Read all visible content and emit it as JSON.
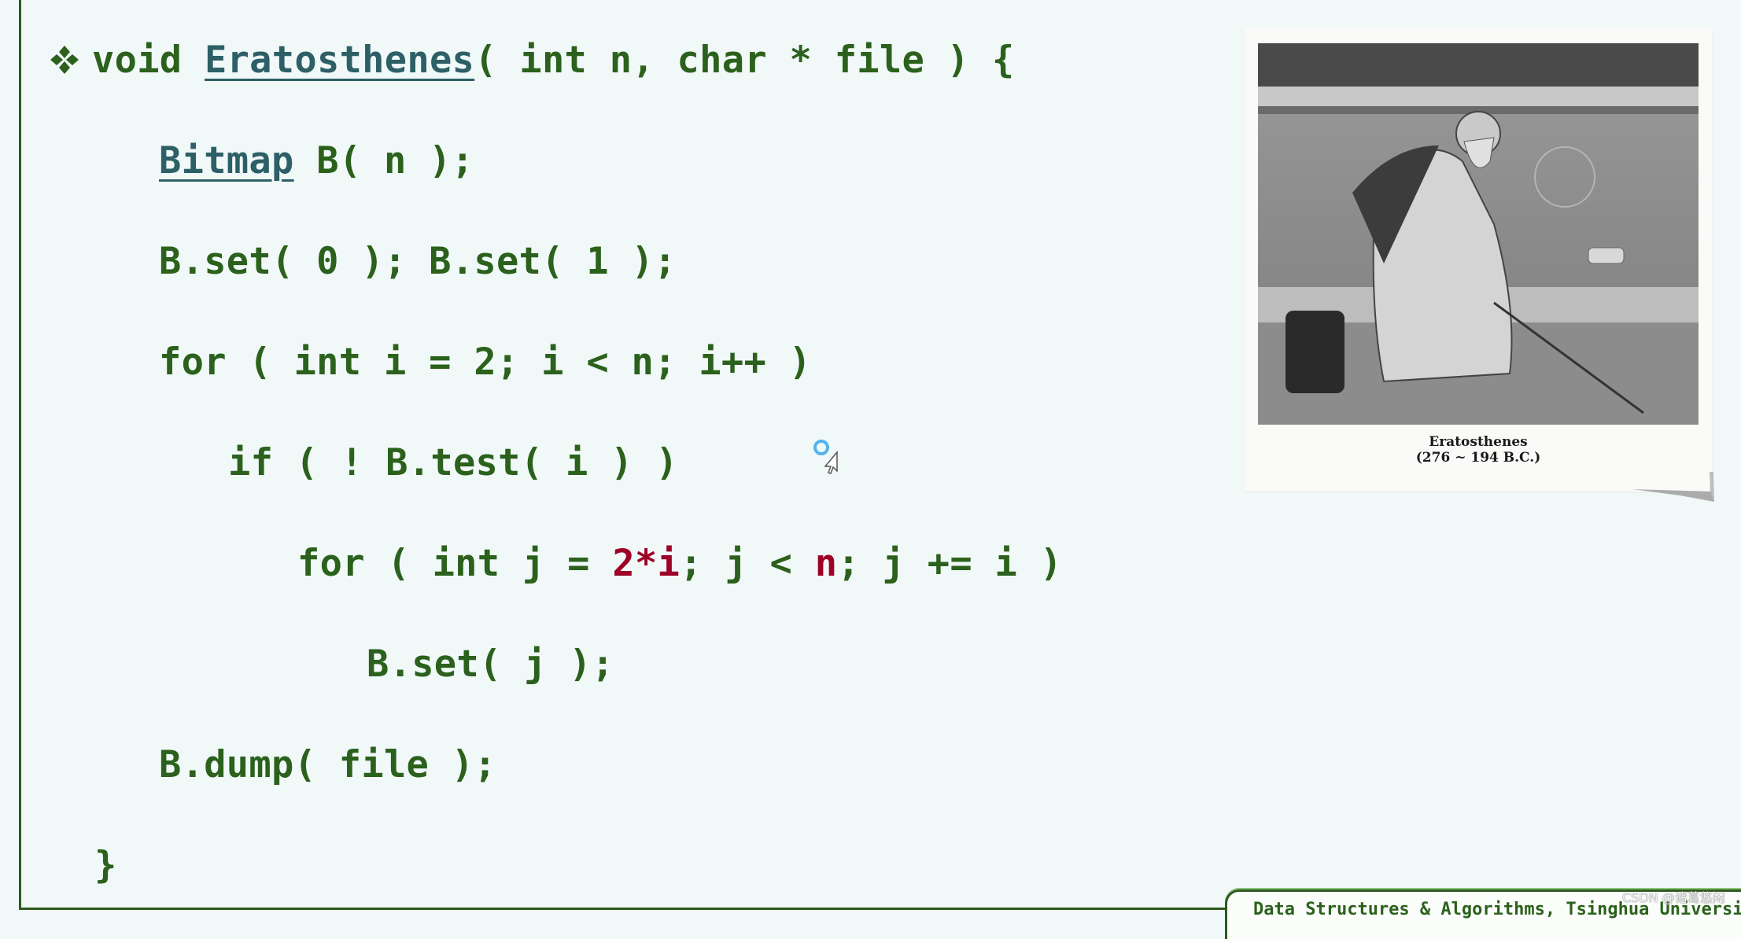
{
  "slide": {
    "code_lines": [
      {
        "indent": 0,
        "parts": [
          {
            "t": "void ",
            "k": "plain"
          },
          {
            "t": "Eratosthenes",
            "k": "fn"
          },
          {
            "t": "( int n, char * file ) {",
            "k": "plain"
          }
        ]
      },
      {
        "indent": 1,
        "parts": [
          {
            "t": "Bitmap",
            "k": "fn"
          },
          {
            "t": " B( n );",
            "k": "plain"
          }
        ]
      },
      {
        "indent": 1,
        "parts": [
          {
            "t": "B.set( 0 ); B.set( 1 );",
            "k": "plain"
          }
        ]
      },
      {
        "indent": 1,
        "parts": [
          {
            "t": "for ( int i = 2; i < n; i++ )",
            "k": "plain"
          }
        ]
      },
      {
        "indent": 2,
        "parts": [
          {
            "t": "if ( ! B.test( i ) )",
            "k": "plain"
          }
        ]
      },
      {
        "indent": 3,
        "parts": [
          {
            "t": "for ( int j = ",
            "k": "plain"
          },
          {
            "t": "2*i",
            "k": "hl"
          },
          {
            "t": "; j < ",
            "k": "plain"
          },
          {
            "t": "n",
            "k": "hl"
          },
          {
            "t": "; j += i )",
            "k": "plain"
          }
        ]
      },
      {
        "indent": 4,
        "parts": [
          {
            "t": "B.set( j );",
            "k": "plain"
          }
        ]
      },
      {
        "indent": 1,
        "parts": [
          {
            "t": "B.dump( file );",
            "k": "plain"
          }
        ]
      },
      {
        "indent": 0,
        "parts": [
          {
            "t": "}",
            "k": "plain"
          }
        ]
      }
    ],
    "bullet_icon": "four-diamond-bullet-icon",
    "colors": {
      "code": "#2b611c",
      "function_link": "#2d5f66",
      "highlight": "#9e0028",
      "frame": "#2d5a1e",
      "background": "#f1f8f8"
    }
  },
  "portrait": {
    "alt": "Engraving of Eratosthenes seated on a stone bench",
    "caption_name": "Eratosthenes",
    "caption_dates": "(276 ~ 194 B.C.)"
  },
  "footer": {
    "course_title": "Data Structures & Algorithms, Tsinghua Universi"
  },
  "watermark": "CSDN @诸葛悠闲",
  "cursor": {
    "icon": "busy-pointer-icon"
  }
}
